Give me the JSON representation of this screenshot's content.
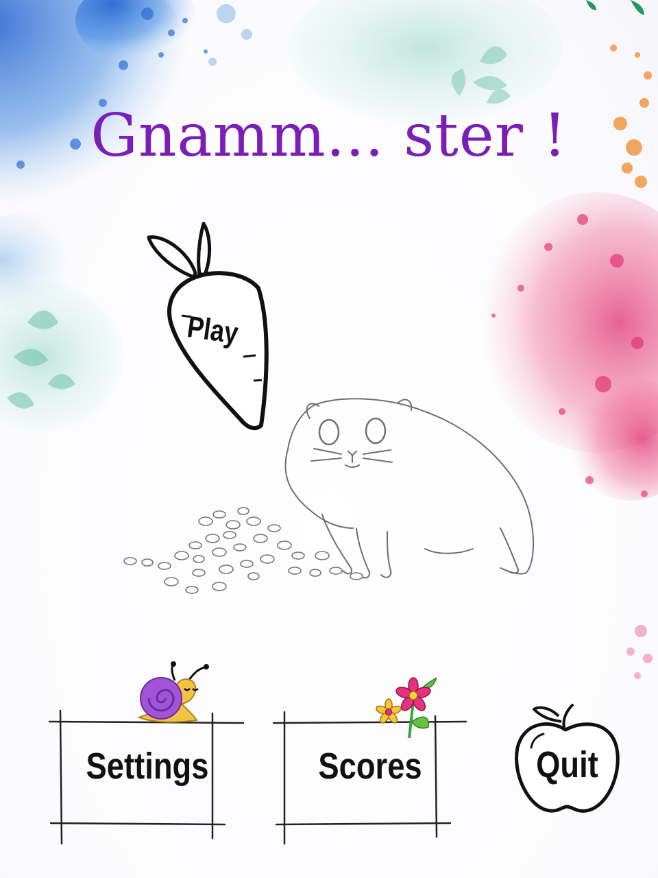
{
  "title": "Gnamm... ster !",
  "menu": {
    "play_label": "Play",
    "settings_label": "Settings",
    "scores_label": "Scores",
    "quit_label": "Quit"
  },
  "icons": {
    "play": "carrot-icon",
    "settings": "snail-icon",
    "scores": "flowers-icon",
    "quit": "apple-icon",
    "mascot": "hamster-illustration"
  },
  "colors": {
    "title": "#7a1fb5",
    "splash_blue": "#2a6fd6",
    "splash_pink": "#e0306e",
    "splash_orange": "#f08a2a",
    "leaf_teal": "#8fd3c0"
  }
}
